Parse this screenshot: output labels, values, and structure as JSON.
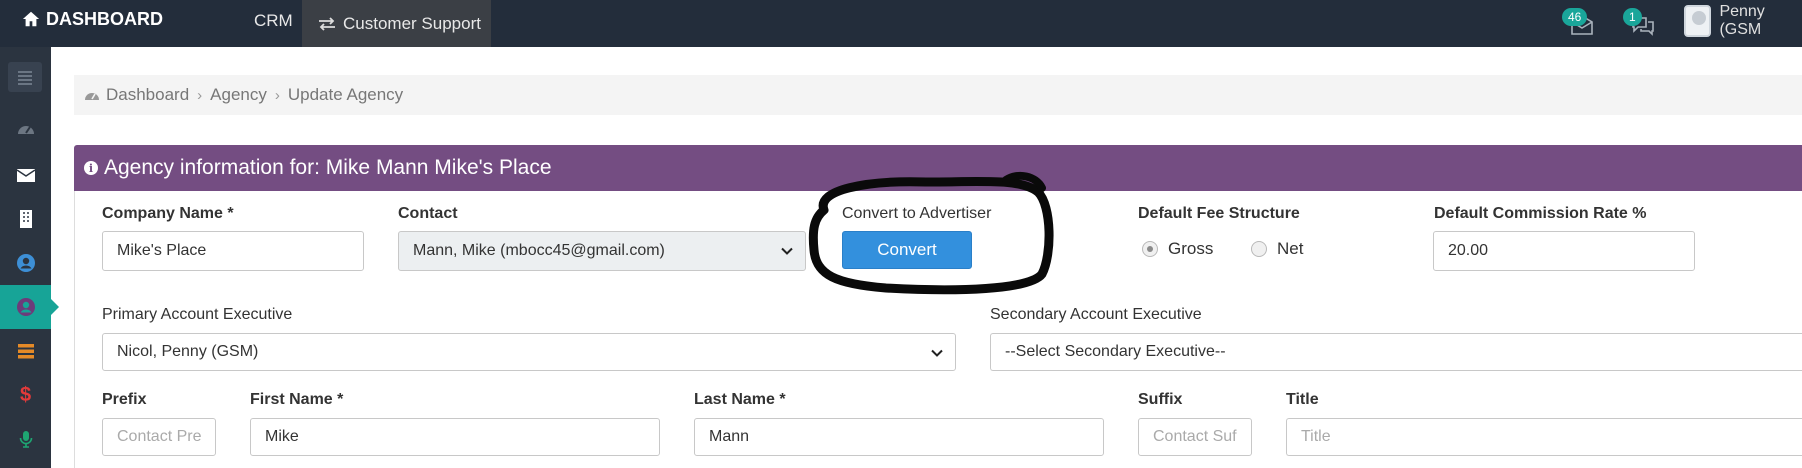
{
  "header": {
    "brand": "DASHBOARD",
    "nav_crm": "CRM",
    "nav_customer_support": "Customer Support",
    "mail_count": "46",
    "chat_count": "1",
    "user_name": "Penny (GSM"
  },
  "sidebar": {
    "items": [
      "menu-toggle",
      "dashboard",
      "mail",
      "building",
      "user-circle",
      "contacts",
      "layers",
      "dollar",
      "microphone"
    ],
    "active": "contacts"
  },
  "breadcrumb": {
    "items": [
      "Dashboard",
      "Agency",
      "Update Agency"
    ]
  },
  "panel": {
    "title": "Agency information for: Mike Mann Mike's Place"
  },
  "form": {
    "company_name_label": "Company Name *",
    "company_name_value": "Mike's Place",
    "contact_label": "Contact",
    "contact_value": "Mann, Mike (mbocc45@gmail.com)",
    "convert_label": "Convert to Advertiser",
    "convert_button": "Convert",
    "fee_label": "Default Fee Structure",
    "fee_options": [
      "Gross",
      "Net"
    ],
    "fee_selected": "Gross",
    "commission_label": "Default Commission Rate %",
    "commission_value": "20.00",
    "primary_exec_label": "Primary Account Executive",
    "primary_exec_value": "Nicol, Penny (GSM)",
    "secondary_exec_label": "Secondary Account Executive",
    "secondary_exec_value": "--Select Secondary Executive--",
    "prefix_label": "Prefix",
    "prefix_placeholder": "Contact Pre",
    "first_name_label": "First Name *",
    "first_name_value": "Mike",
    "last_name_label": "Last Name *",
    "last_name_value": "Mann",
    "suffix_label": "Suffix",
    "suffix_placeholder": "Contact Suf",
    "title_label": "Title",
    "title_placeholder": "Title"
  },
  "colors": {
    "topbar": "#232d3b",
    "sidebar": "#2b3440",
    "accent_teal": "#17a497",
    "panel_header": "#744d82",
    "button_blue": "#3390dd"
  }
}
